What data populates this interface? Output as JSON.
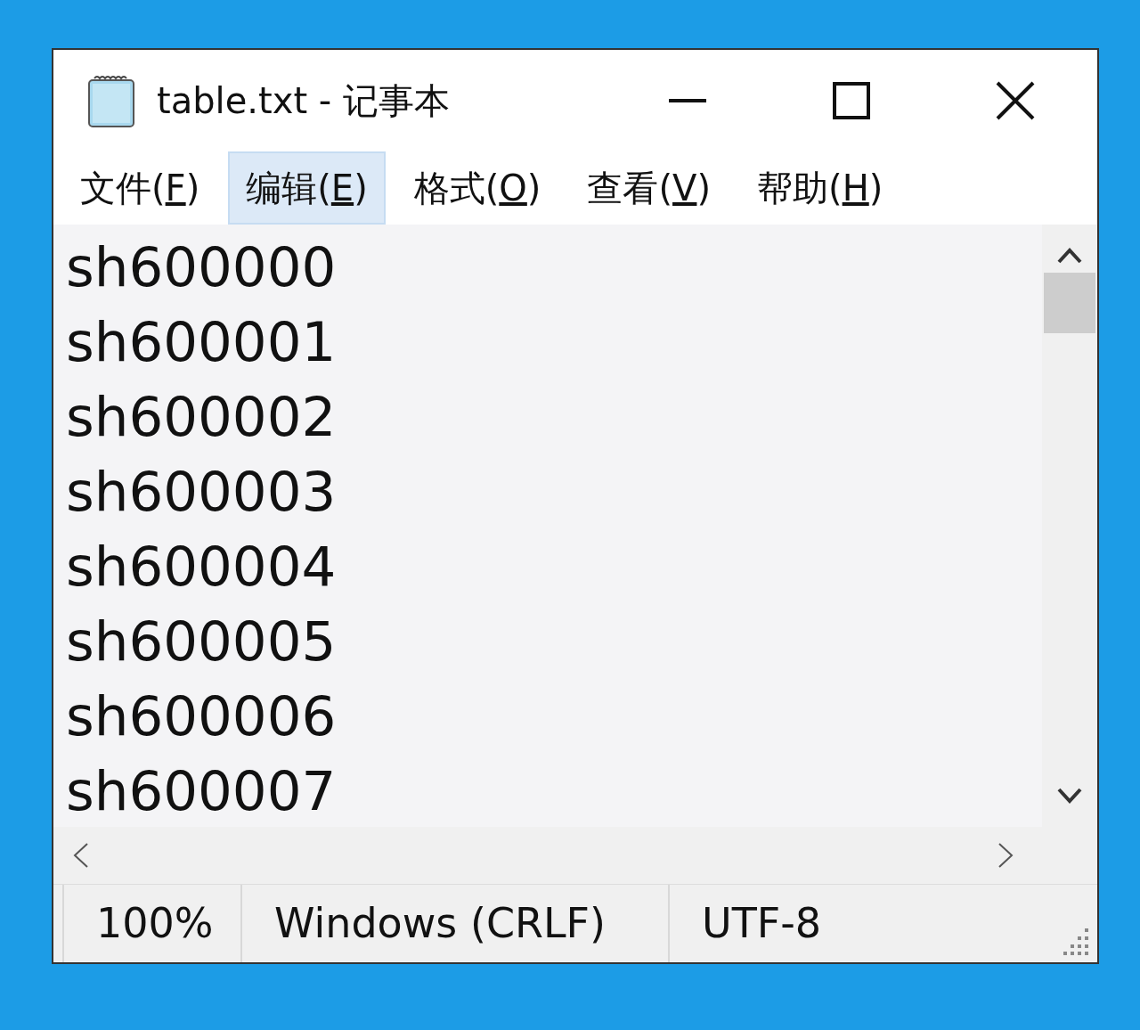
{
  "window": {
    "title": "table.txt - 记事本"
  },
  "menu": [
    {
      "label": "文件(F)",
      "selected": false
    },
    {
      "label": "编辑(E)",
      "selected": true
    },
    {
      "label": "格式(O)",
      "selected": false
    },
    {
      "label": "查看(V)",
      "selected": false
    },
    {
      "label": "帮助(H)",
      "selected": false
    }
  ],
  "lines": [
    "sh600000",
    "sh600001",
    "sh600002",
    "sh600003",
    "sh600004",
    "sh600005",
    "sh600006",
    "sh600007"
  ],
  "status_bar": {
    "zoom": "100%",
    "line_ending": "Windows (CRLF)",
    "encoding": "UTF-8"
  }
}
